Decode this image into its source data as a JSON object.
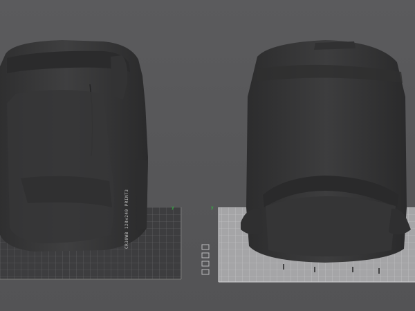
{
  "viewport": {
    "background": "#58585a",
    "plate_left_color": "#3e3e40",
    "plate_right_color": "#a3a3a5",
    "grid_left_color": "#6b6b6d",
    "grid_right_color": "#c4c4c6",
    "model_color": "#3a3a3b"
  },
  "left_plate": {
    "side_label": "CR30WB 120x240 PRINT3",
    "axis_label": "y"
  },
  "right_plate": {
    "axis_label": "y"
  },
  "icons": [
    "plate-corner-icon",
    "plate-corner-icon",
    "plate-corner-icon",
    "plate-corner-icon"
  ]
}
